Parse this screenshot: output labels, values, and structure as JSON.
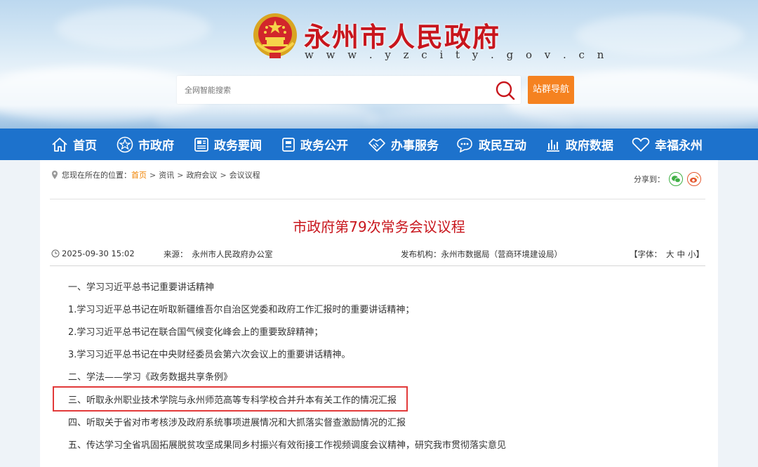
{
  "header": {
    "site_title": "永州市人民政府",
    "site_url": "w w w . y z c i t y . g o v . c n",
    "search_placeholder": "全网智能搜索",
    "site_nav_button": "站群导航"
  },
  "nav": {
    "items": [
      {
        "label": "首页",
        "icon": "home-icon"
      },
      {
        "label": "市政府",
        "icon": "star-icon"
      },
      {
        "label": "政务要闻",
        "icon": "newspaper-icon"
      },
      {
        "label": "政务公开",
        "icon": "document-icon"
      },
      {
        "label": "办事服务",
        "icon": "handshake-icon"
      },
      {
        "label": "政民互动",
        "icon": "chat-icon"
      },
      {
        "label": "政府数据",
        "icon": "bar-chart-icon"
      },
      {
        "label": "幸福永州",
        "icon": "heart-icon"
      }
    ]
  },
  "breadcrumb": {
    "prefix": "您现在所在的位置：",
    "items": [
      "首页",
      "资讯",
      "政府会议",
      "会议议程"
    ],
    "separator": ">"
  },
  "share": {
    "label": "分享到：",
    "icons": [
      "wechat-icon",
      "weibo-icon"
    ]
  },
  "article": {
    "title": "市政府第79次常务会议议程",
    "date": "2025-09-30 15:02",
    "source_label": "来源：",
    "source": "永州市人民政府办公室",
    "publisher_label": "发布机构：",
    "publisher": "永州市数据局（营商环境建设局）",
    "font_size_label": "【字体：",
    "font_sizes": [
      "大",
      "中",
      "小"
    ],
    "font_size_close": "】",
    "lines": [
      "一、学习习近平总书记重要讲话精神",
      "1.学习习近平总书记在听取新疆维吾尔自治区党委和政府工作汇报时的重要讲话精神；",
      "2.学习习近平总书记在联合国气候变化峰会上的重要致辞精神；",
      "3.学习习近平总书记在中央财经委员会第六次会议上的重要讲话精神。",
      "二、学法——学习《政务数据共享条例》",
      "三、听取永州职业技术学院与永州师范高等专科学校合并升本有关工作的情况汇报",
      "四、听取关于省对市考核涉及政府系统事项进展情况和大抓落实督查激励情况的汇报",
      "五、传达学习全省巩固拓展脱贫攻坚成果同乡村振兴有效衔接工作视频调度会议精神，研究我市贯彻落实意见"
    ]
  },
  "colors": {
    "brand_red": "#c8161d",
    "nav_blue": "#1d72cc",
    "accent_orange": "#f58220",
    "highlight_red": "#e23a3a"
  }
}
